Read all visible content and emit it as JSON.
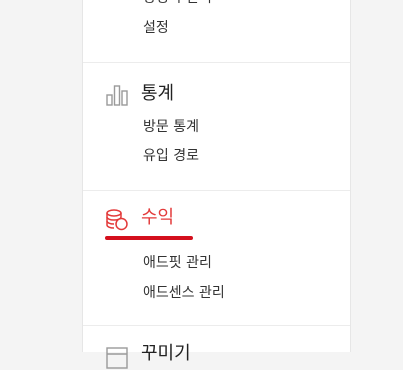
{
  "menu": {
    "cut_top_item": "방명록 관리",
    "settings": "설정",
    "stats": {
      "label": "통계",
      "icon": "bar-chart-icon",
      "items": [
        "방문 통계",
        "유입 경로"
      ]
    },
    "revenue": {
      "label": "수익",
      "icon": "coins-icon",
      "active": true,
      "active_color": "#e33a3a",
      "items": [
        "애드핏 관리",
        "애드센스 관리"
      ]
    },
    "next_section_label": "꾸미기"
  }
}
